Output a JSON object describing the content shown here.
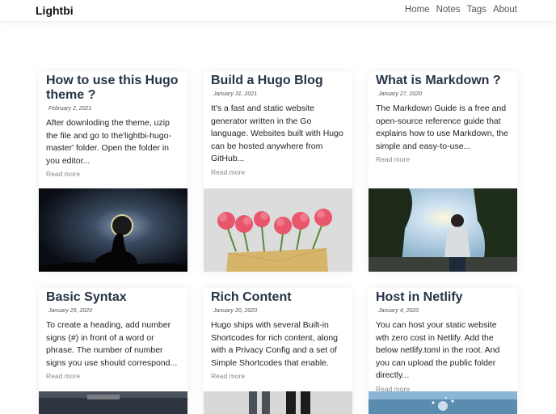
{
  "navbar": {
    "brand": "Lightbi",
    "links": [
      "Home",
      "Notes",
      "Tags",
      "About"
    ]
  },
  "posts": [
    {
      "title": "How to use this Hugo theme ?",
      "date": "February 2, 2021",
      "excerpt": "After downloding the theme, uzip the file and go to the'lightbi-hugo-master' folder. Open the folder in you editor...",
      "read_more": "Read more",
      "image": "silhouette-moon-image"
    },
    {
      "title": "Build a Hugo Blog",
      "date": "January 31, 2021",
      "excerpt": "It's a fast and static website generator written in the Go language. Websites built with Hugo can be hosted anywhere from GitHub...",
      "read_more": "Read more",
      "image": "pink-flowers-envelope-image"
    },
    {
      "title": "What is Markdown ?",
      "date": "January 27, 2020",
      "excerpt": "The Markdown Guide is a free and open-source reference guide that explains how to use Markdown, the simple and easy-to-use...",
      "read_more": "Read more",
      "image": "person-sunset-park-image"
    },
    {
      "title": "Basic Syntax",
      "date": "January 25, 2020",
      "excerpt": "To create a heading, add number signs (#) in front of a word or phrase. The number of number signs you use should correspond...",
      "read_more": "Read more",
      "image": "dark-landscape-image"
    },
    {
      "title": "Rich Content",
      "date": "January 20, 2020",
      "excerpt": "Hugo ships with several Built-in Shortcodes for rich content, along with a Privacy Config and a set of Simple Shortcodes that enable.",
      "read_more": "Read more",
      "image": "people-legs-image"
    },
    {
      "title": "Host in Netlify",
      "date": "January 4, 2020",
      "excerpt": "You can host your static website wth zero cost in Netlify. Add the below netlify.toml in the root. And you can upload the public folder directly...",
      "read_more": "Read more",
      "image": "blue-sparkle-image"
    }
  ]
}
